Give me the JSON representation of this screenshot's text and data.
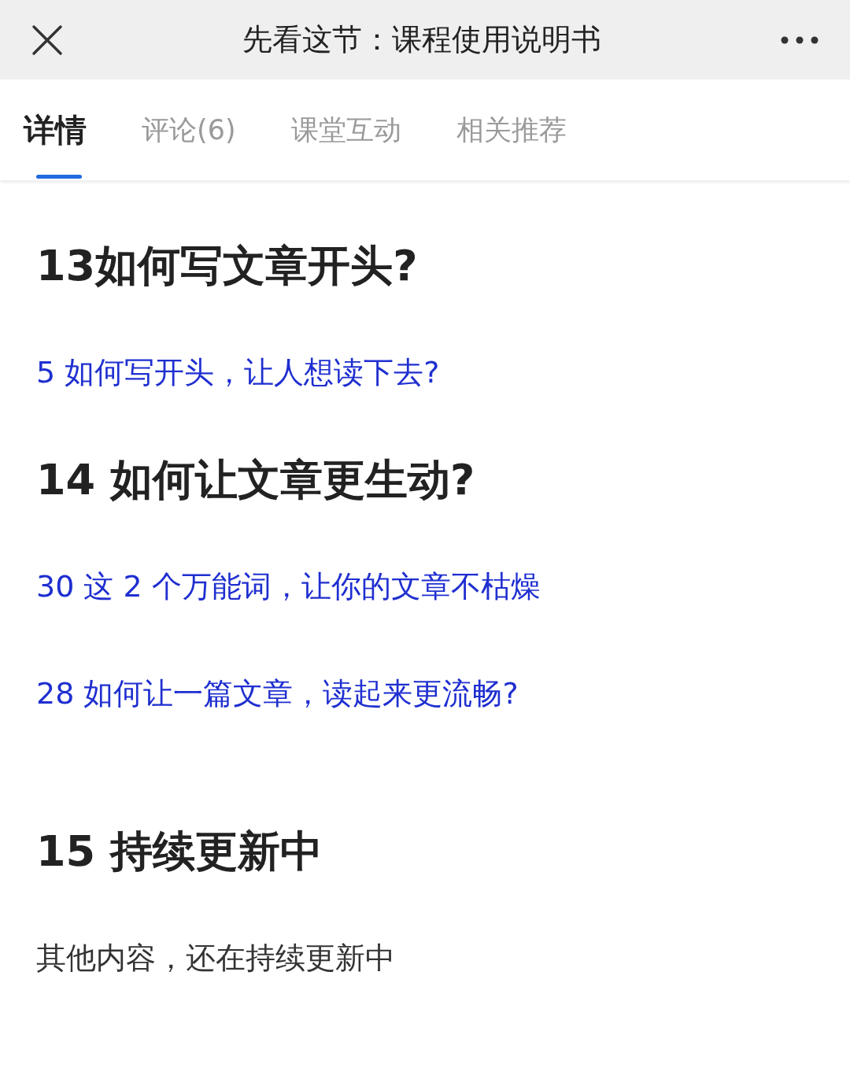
{
  "header": {
    "title": "先看这节：课程使用说明书"
  },
  "tabs": [
    {
      "label": "详情",
      "selected": true
    },
    {
      "label": "评论(6)",
      "selected": false
    },
    {
      "label": "课堂互动",
      "selected": false
    },
    {
      "label": "相关推荐",
      "selected": false
    }
  ],
  "content": [
    {
      "kind": "heading",
      "text": "13如何写文章开头?"
    },
    {
      "kind": "link",
      "text": "5 如何写开头，让人想读下去?"
    },
    {
      "kind": "heading",
      "text": "14 如何让文章更生动?"
    },
    {
      "kind": "link",
      "text": "30 这 2 个万能词，让你的文章不枯燥"
    },
    {
      "kind": "link",
      "text": "28 如何让一篇文章，读起来更流畅?"
    },
    {
      "kind": "heading",
      "text": "15 持续更新中"
    },
    {
      "kind": "text",
      "text": "其他内容，还在持续更新中"
    }
  ]
}
